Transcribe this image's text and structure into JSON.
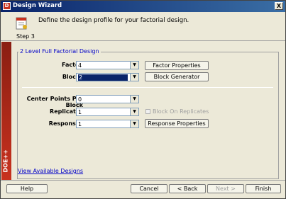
{
  "window": {
    "title": "Design Wizard",
    "close_symbol": "X",
    "app_icon_letter": "D"
  },
  "header": {
    "description": "Define the design profile for your factorial design.",
    "step": "Step 3"
  },
  "sidebar": {
    "brand": "DOE++"
  },
  "group": {
    "title": "2 Level Full Factorial Design"
  },
  "fields": {
    "factors": {
      "label": "Factors",
      "value": "4"
    },
    "blocks": {
      "label": "Blocks",
      "value": "2"
    },
    "center_points": {
      "label": "Center Points Per Block",
      "value": "0"
    },
    "replicates": {
      "label": "Replicates",
      "value": "1"
    },
    "responses": {
      "label": "Responses",
      "value": "1"
    }
  },
  "buttons": {
    "factor_properties": "Factor Properties",
    "block_generator": "Block Generator",
    "response_properties": "Response Properties",
    "help": "Help",
    "cancel": "Cancel",
    "back": "< Back",
    "next": "Next >",
    "finish": "Finish"
  },
  "checkbox": {
    "block_on_replicates": "Block On Replicates"
  },
  "links": {
    "view_available_designs": "View Available Designs"
  },
  "icons": {
    "dropdown_arrow": "▼"
  }
}
